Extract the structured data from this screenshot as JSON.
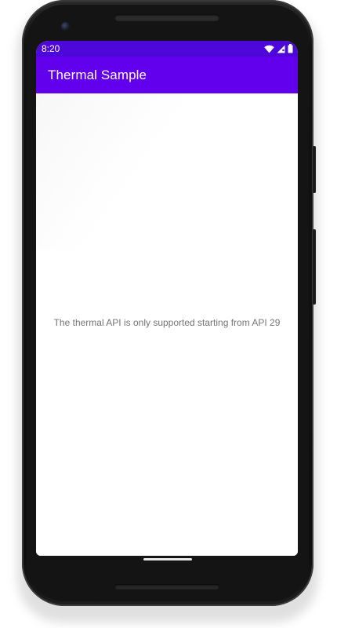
{
  "status_bar": {
    "time": "8:20",
    "icons": [
      "wifi-icon",
      "cellular-signal-icon",
      "battery-icon"
    ]
  },
  "app_bar": {
    "title": "Thermal Sample"
  },
  "content": {
    "message": "The thermal API is only supported starting from API 29"
  },
  "colors": {
    "status_bar": "#4d07d8",
    "app_bar": "#6200ee",
    "message_text": "#757575"
  }
}
